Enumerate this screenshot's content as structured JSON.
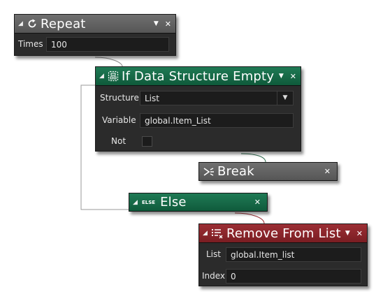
{
  "blocks": {
    "repeat": {
      "title": "Repeat",
      "icon": "loop-arrow-icon",
      "times_label": "Times",
      "times_value": "100"
    },
    "if_empty": {
      "title": "If Data Structure Empty",
      "icon": "data-structure-icon",
      "structure_label": "Structure",
      "structure_value": "List",
      "variable_label": "Variable",
      "variable_value": "global.Item_List",
      "not_label": "Not",
      "not_checked": false
    },
    "break": {
      "title": "Break",
      "icon": "break-icon"
    },
    "else": {
      "title": "Else",
      "badge": "ELSE"
    },
    "remove": {
      "title": "Remove From List",
      "icon": "list-remove-icon",
      "list_label": "List",
      "list_value": "global.Item_list",
      "index_label": "Index",
      "index_value": "0"
    }
  },
  "controls": {
    "collapse_glyph": "◢",
    "menu_glyph": "▼",
    "close_glyph": "✕",
    "dropdown_glyph": "▼"
  },
  "colors": {
    "grey_header": "#626262",
    "green_header": "#16684a",
    "red_header": "#8c262c",
    "body": "#2b2b2b"
  }
}
